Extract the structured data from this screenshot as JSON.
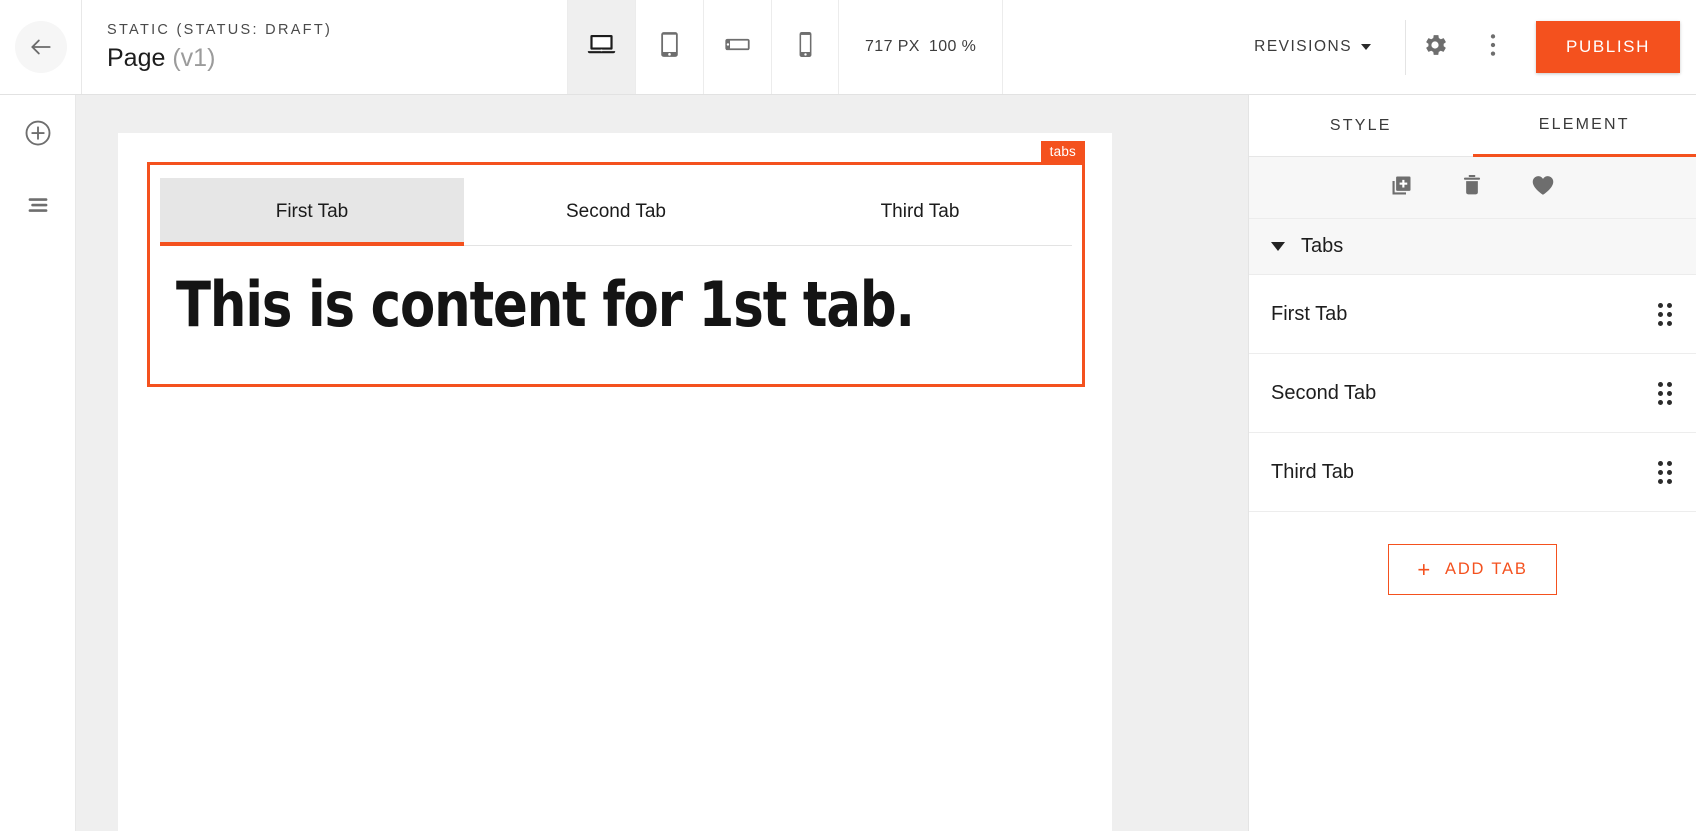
{
  "topbar": {
    "back_icon": "arrow-left-icon",
    "kicker": "STATIC (STATUS: DRAFT)",
    "page_name": "Page",
    "page_version": "(v1)",
    "devices": [
      {
        "name": "desktop",
        "icon": "laptop-icon",
        "active": true
      },
      {
        "name": "tablet-portrait",
        "icon": "tablet-portrait-icon",
        "active": false
      },
      {
        "name": "tablet-landscape",
        "icon": "tablet-landscape-icon",
        "active": false
      },
      {
        "name": "mobile",
        "icon": "phone-icon",
        "active": false
      }
    ],
    "viewport_width": "717 PX",
    "zoom_level": "100 %",
    "revisions_label": "REVISIONS",
    "settings_icon": "gear-icon",
    "more_icon": "kebab-menu-icon",
    "publish_label": "PUBLISH"
  },
  "left_rail": {
    "items": [
      {
        "name": "add-element",
        "icon": "plus-circle-icon"
      },
      {
        "name": "layers",
        "icon": "layers-list-icon"
      }
    ]
  },
  "canvas": {
    "selection_badge": "tabs",
    "tabs": [
      {
        "label": "First Tab",
        "active": true
      },
      {
        "label": "Second Tab",
        "active": false
      },
      {
        "label": "Third Tab",
        "active": false
      }
    ],
    "content_heading": "This is content for 1st tab."
  },
  "right_panel": {
    "tabs": [
      {
        "label": "STYLE",
        "active": false
      },
      {
        "label": "ELEMENT",
        "active": true
      }
    ],
    "actions": [
      {
        "name": "duplicate",
        "icon": "duplicate-icon"
      },
      {
        "name": "delete",
        "icon": "trash-icon"
      },
      {
        "name": "favorite",
        "icon": "heart-icon"
      }
    ],
    "section": {
      "title": "Tabs",
      "expanded": true,
      "items": [
        {
          "label": "First Tab"
        },
        {
          "label": "Second Tab"
        },
        {
          "label": "Third Tab"
        }
      ]
    },
    "add_tab_label": "ADD TAB",
    "add_tab_plus": "+"
  },
  "colors": {
    "accent": "#f4511e",
    "canvas_bg": "#efefef",
    "panel_bg": "#f7f7f7",
    "text": "#1d1d1d"
  }
}
